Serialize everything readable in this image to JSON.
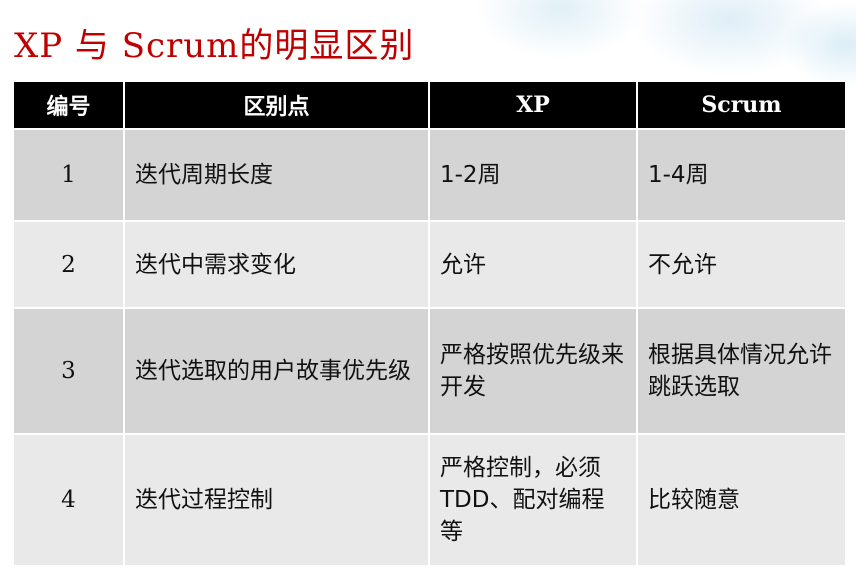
{
  "title": "XP 与 Scrum的明显区别",
  "table": {
    "headers": [
      "编号",
      "区别点",
      "XP",
      "Scrum"
    ],
    "rows": [
      [
        "1",
        "迭代周期长度",
        "1-2周",
        "1-4周"
      ],
      [
        "2",
        "迭代中需求变化",
        "允许",
        "不允许"
      ],
      [
        "3",
        "迭代选取的用户故事优先级",
        "严格按照优先级来开发",
        "根据具体情况允许跳跃选取"
      ],
      [
        "4",
        "迭代过程控制",
        "严格控制，必须TDD、配对编程等",
        "比较随意"
      ]
    ]
  }
}
